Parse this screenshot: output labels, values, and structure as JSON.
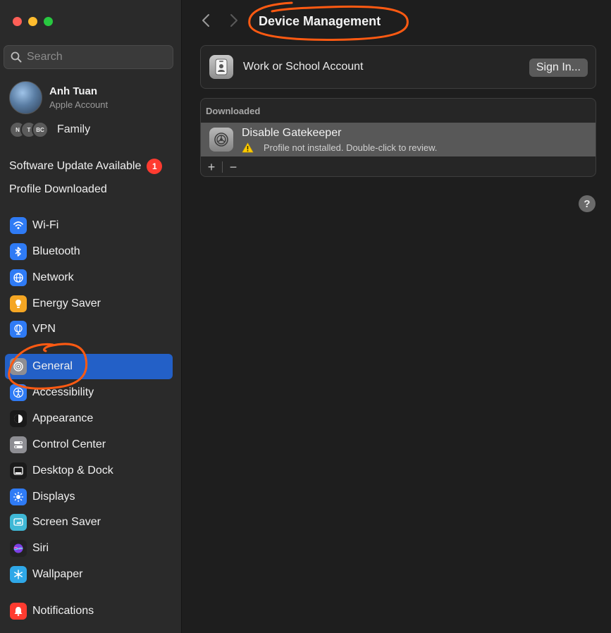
{
  "window": {
    "traffic_lights": {
      "close": "#fe5f57",
      "minimize": "#febc2e",
      "maximize": "#28c840"
    }
  },
  "sidebar": {
    "search": {
      "placeholder": "Search",
      "value": ""
    },
    "account": {
      "name": "Anh Tuan",
      "subtitle": "Apple Account"
    },
    "family": {
      "label": "Family",
      "avatars": [
        "N",
        "T",
        "BC"
      ]
    },
    "notices": {
      "software_update": "Software Update Available",
      "update_badge": "1",
      "profile_downloaded": "Profile Downloaded"
    },
    "items": [
      {
        "label": "Wi-Fi",
        "icon": "wifi-icon",
        "color": "#2f7bf5"
      },
      {
        "label": "Bluetooth",
        "icon": "bluetooth-icon",
        "color": "#2f7bf5"
      },
      {
        "label": "Network",
        "icon": "globe-icon",
        "color": "#2f7bf5"
      },
      {
        "label": "Energy Saver",
        "icon": "lightbulb-icon",
        "color": "#f5a623"
      },
      {
        "label": "VPN",
        "icon": "vpn-globe-icon",
        "color": "#2f7bf5"
      },
      {
        "label": "General",
        "icon": "gear-icon",
        "color": "#8e8e93",
        "selected": true
      },
      {
        "label": "Accessibility",
        "icon": "accessibility-icon",
        "color": "#2f7bf5"
      },
      {
        "label": "Appearance",
        "icon": "appearance-icon",
        "color": "#1a1a1a"
      },
      {
        "label": "Control Center",
        "icon": "control-center-icon",
        "color": "#8e8e93"
      },
      {
        "label": "Desktop & Dock",
        "icon": "dock-icon",
        "color": "#1a1a1a"
      },
      {
        "label": "Displays",
        "icon": "sun-icon",
        "color": "#2f7bf5"
      },
      {
        "label": "Screen Saver",
        "icon": "screen-saver-icon",
        "color": "#3fb8d6"
      },
      {
        "label": "Siri",
        "icon": "siri-icon",
        "color": "#222222"
      },
      {
        "label": "Wallpaper",
        "icon": "snowflake-icon",
        "color": "#2fa8e8"
      },
      {
        "label": "Notifications",
        "icon": "bell-icon",
        "color": "#ff3b30"
      }
    ],
    "selected_color": "#2360c7"
  },
  "main": {
    "title": "Device Management",
    "account_card": {
      "label": "Work or School Account",
      "button": "Sign In..."
    },
    "downloaded": {
      "header": "Downloaded",
      "profile_name": "Disable Gatekeeper",
      "profile_status": "Profile not installed. Double-click to review.",
      "add_label": "+",
      "remove_label": "−"
    },
    "help_label": "?",
    "annotation_color": "#ff5a12"
  }
}
